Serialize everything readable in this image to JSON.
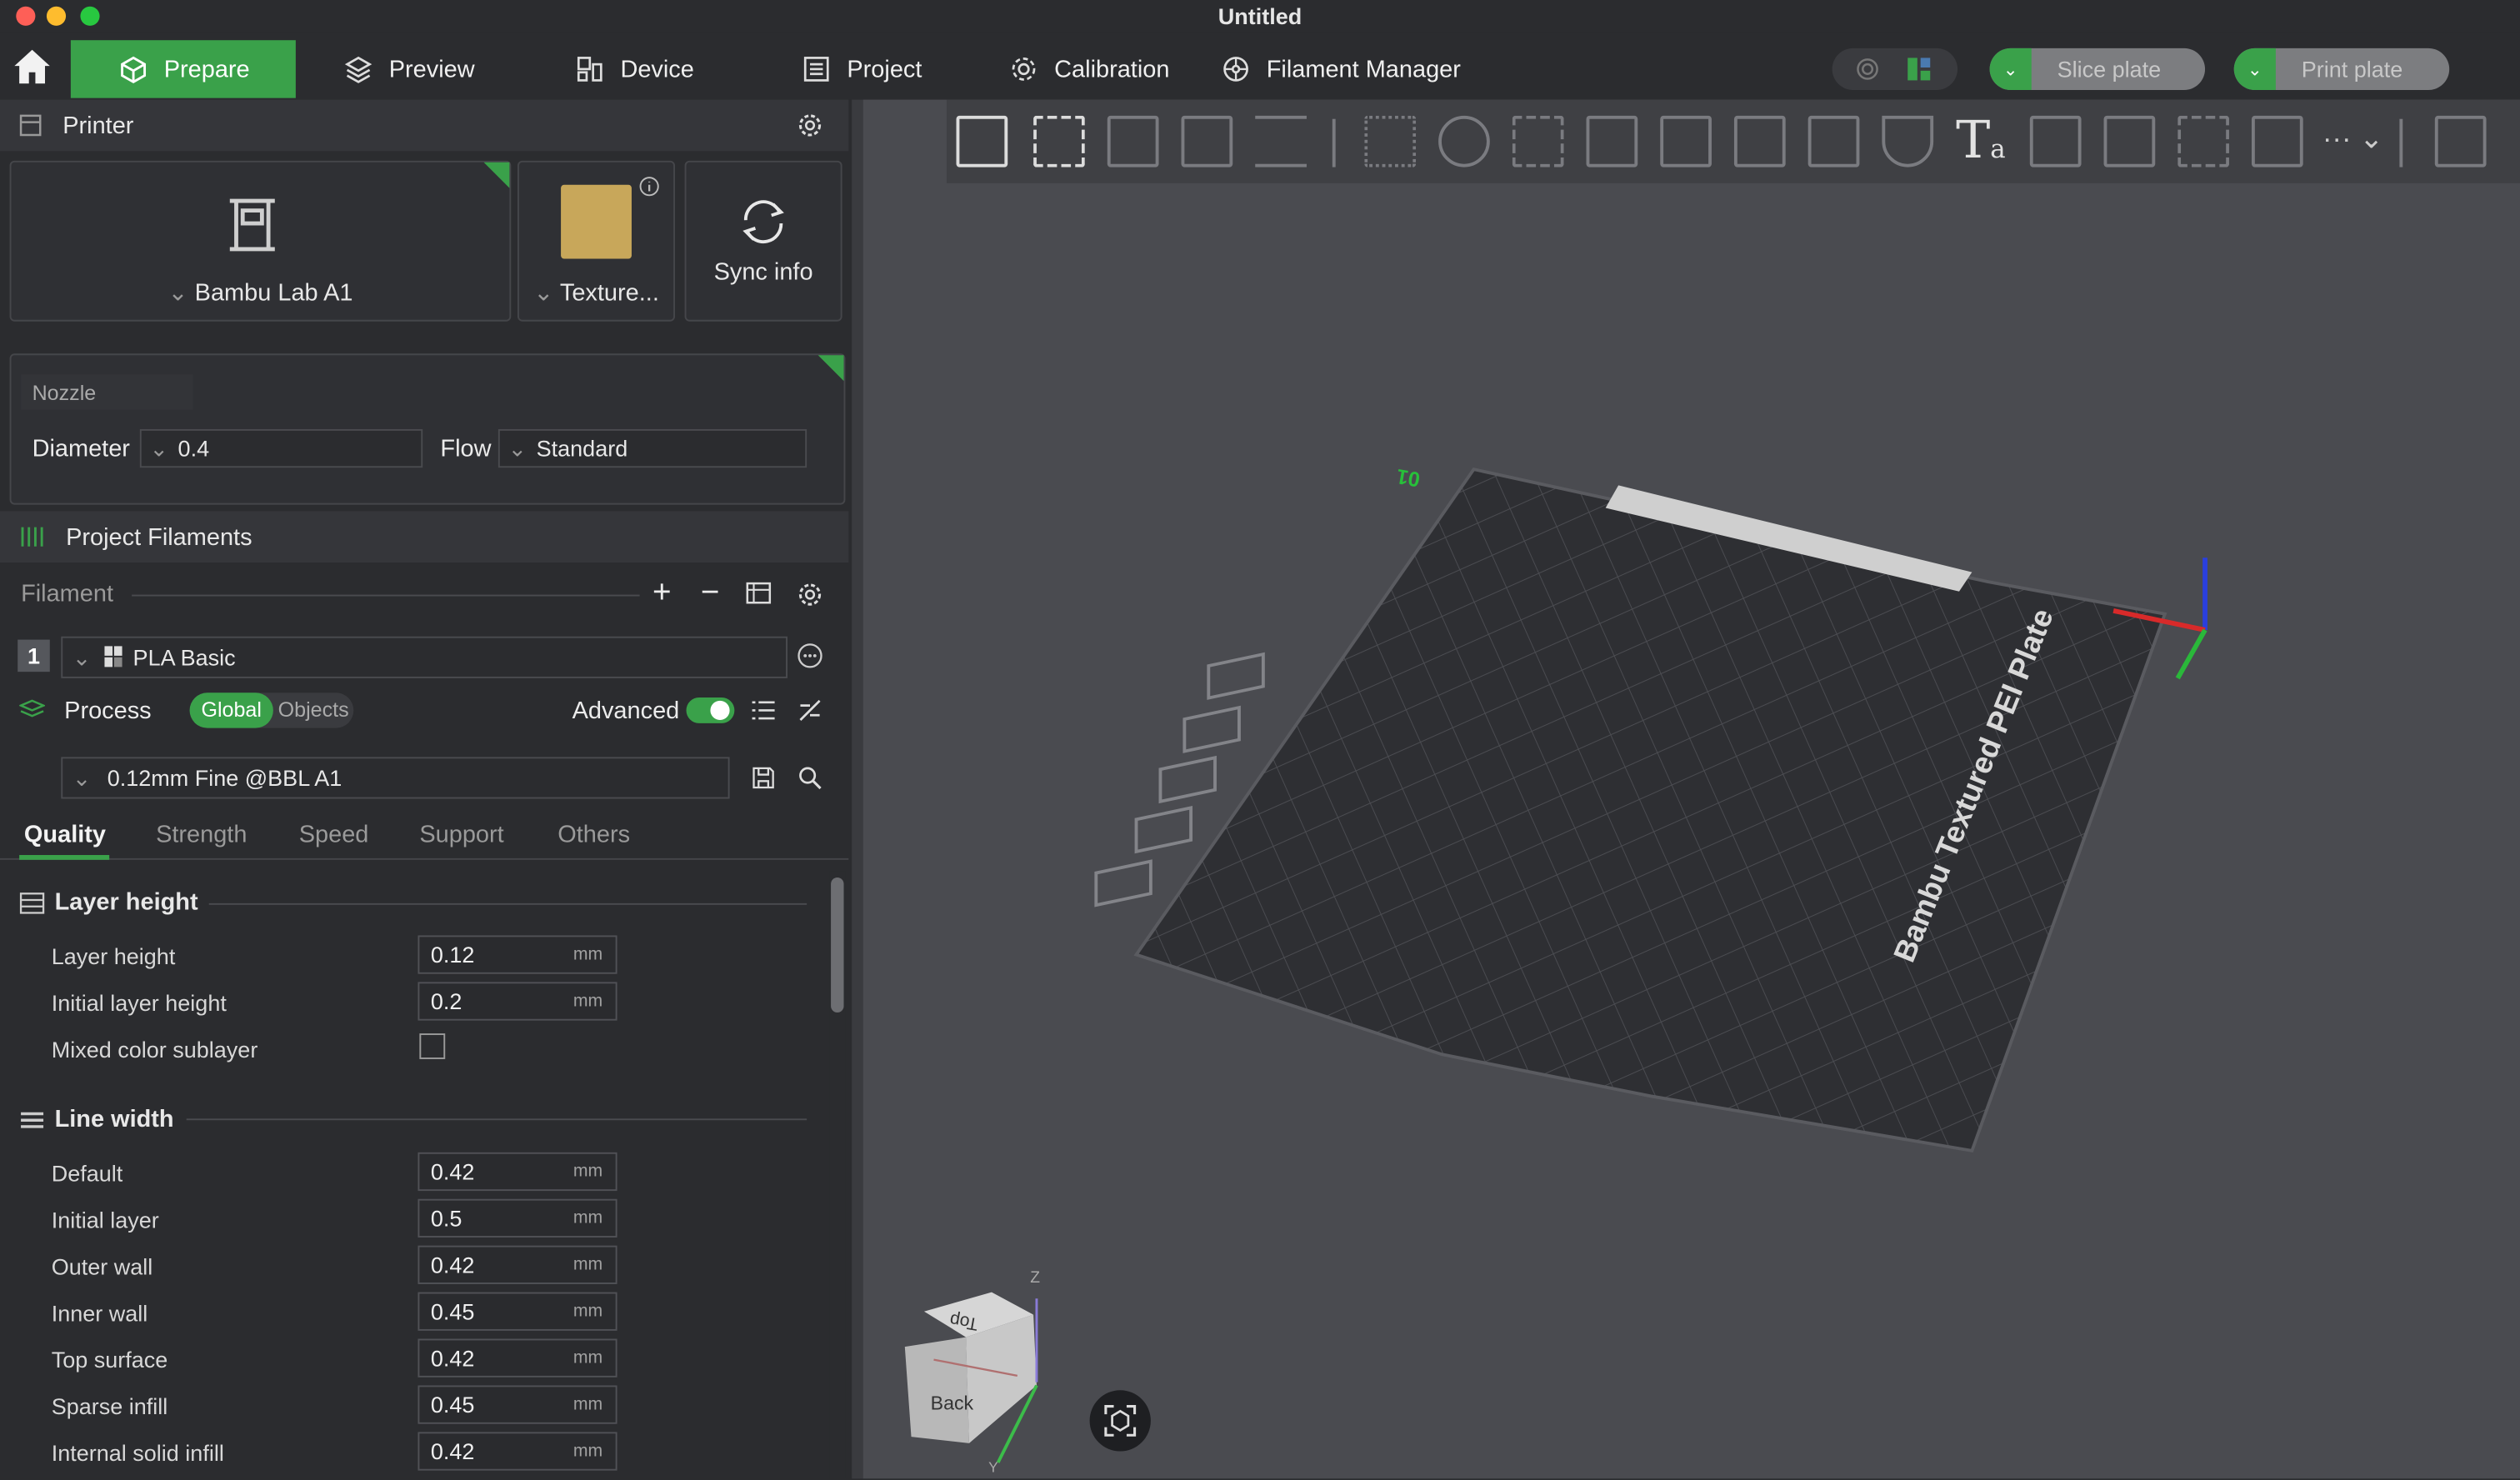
{
  "window": {
    "title": "Untitled"
  },
  "nav": {
    "tabs": [
      "Prepare",
      "Preview",
      "Device",
      "Project",
      "Calibration",
      "Filament Manager"
    ],
    "active": "Prepare"
  },
  "actions": {
    "slice": "Slice plate",
    "print": "Print plate"
  },
  "printer": {
    "header": "Printer",
    "name": "Bambu Lab A1",
    "plate": "Texture...",
    "sync": "Sync info",
    "nozzle_label": "Nozzle",
    "diameter_label": "Diameter",
    "diameter": "0.4",
    "flow_label": "Flow",
    "flow": "Standard"
  },
  "filaments": {
    "header": "Project Filaments",
    "label": "Filament",
    "items": [
      {
        "index": "1",
        "name": "PLA Basic"
      }
    ]
  },
  "process": {
    "header": "Process",
    "toggle": [
      "Global",
      "Objects"
    ],
    "advanced": "Advanced",
    "preset": "0.12mm Fine @BBL A1",
    "tabs": [
      "Quality",
      "Strength",
      "Speed",
      "Support",
      "Others"
    ],
    "active_tab": "Quality",
    "groups": [
      {
        "title": "Layer height",
        "rows": [
          {
            "label": "Layer height",
            "value": "0.12",
            "unit": "mm"
          },
          {
            "label": "Initial layer height",
            "value": "0.2",
            "unit": "mm"
          },
          {
            "label": "Mixed color sublayer",
            "checkbox": true
          }
        ]
      },
      {
        "title": "Line width",
        "rows": [
          {
            "label": "Default",
            "value": "0.42",
            "unit": "mm"
          },
          {
            "label": "Initial layer",
            "value": "0.5",
            "unit": "mm"
          },
          {
            "label": "Outer wall",
            "value": "0.42",
            "unit": "mm"
          },
          {
            "label": "Inner wall",
            "value": "0.45",
            "unit": "mm"
          },
          {
            "label": "Top surface",
            "value": "0.42",
            "unit": "mm"
          },
          {
            "label": "Sparse infill",
            "value": "0.45",
            "unit": "mm"
          },
          {
            "label": "Internal solid infill",
            "value": "0.42",
            "unit": "mm"
          }
        ]
      }
    ]
  },
  "viewport": {
    "plate_label": "Bambu Textured PEI Plate",
    "plate_number": "01",
    "cube_top": "Top",
    "cube_back": "Back",
    "axis_z": "Z",
    "axis_y": "Y"
  },
  "colors": {
    "accent": "#3aa14a",
    "panel": "#2b2c2f",
    "viewport": "#4a4b50"
  },
  "icons": [
    "home-icon",
    "cube-icon",
    "layers-icon",
    "device-icon",
    "list-icon",
    "gear-icon",
    "filament-icon",
    "search-icon",
    "save-icon",
    "sync-icon"
  ]
}
